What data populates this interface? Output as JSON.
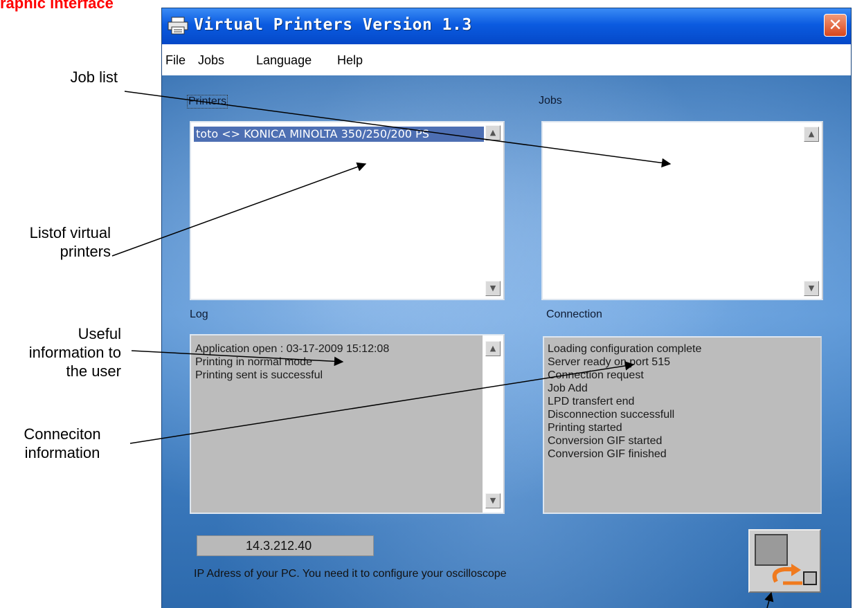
{
  "page_heading": "raphic interface",
  "callouts": {
    "job_list": "Job list",
    "printer_list_line1": "Listof virtual",
    "printer_list_line2": "printers",
    "useful_line1": "Useful",
    "useful_line2": "information to",
    "useful_line3": "the user",
    "connection_line1": "Conneciton",
    "connection_line2": "information"
  },
  "window": {
    "title": "Virtual Printers Version 1.3",
    "close_glyph": "✕"
  },
  "menu": [
    "File",
    "Jobs",
    "Language",
    "Help"
  ],
  "printers": {
    "label": "Printers",
    "items": [
      "toto <> KONICA MINOLTA 350/250/200 PS"
    ]
  },
  "jobs": {
    "label": "Jobs",
    "items": []
  },
  "log": {
    "label": "Log",
    "lines": [
      "Application open : 03-17-2009  15:12:08",
      "Printing in normal mode",
      "Printing sent is successful"
    ]
  },
  "connection": {
    "label": "Connection",
    "lines": [
      "Loading configuration complete",
      "Server ready on port 515",
      "Connection request",
      "Job Add",
      "LPD transfert end",
      "Disconnection successfull",
      "Printing started",
      "Conversion GIF started",
      "Conversion GIF finished"
    ]
  },
  "ip": {
    "value": "14.3.212.40",
    "hint": "IP Adress of your PC. You need it to configure your oscilloscope"
  },
  "icons": {
    "app": "printer-icon",
    "refresh": "refresh-icon",
    "scroll_up": "scroll-up-icon",
    "scroll_down": "scroll-down-icon"
  },
  "colors": {
    "heading": "#ff0000",
    "titlebar": "#0b5be0",
    "selection": "#4d6fb3"
  }
}
